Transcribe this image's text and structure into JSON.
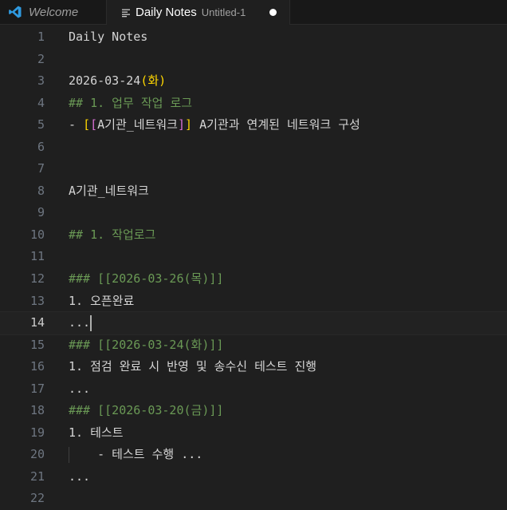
{
  "tabs": [
    {
      "label": "Welcome",
      "icon": "vscode-logo-icon"
    },
    {
      "label": "Daily Notes",
      "description": "Untitled-1",
      "icon": "file-lines-icon",
      "dirty": true
    }
  ],
  "lines": [
    {
      "n": "1",
      "text": "Daily Notes"
    },
    {
      "n": "2",
      "text": ""
    },
    {
      "n": "3",
      "date": "2026-03-24",
      "paren": "(화)"
    },
    {
      "n": "4",
      "text": "## 1. 업무 작업 로그"
    },
    {
      "n": "5",
      "prefix": "- ",
      "link": "A기관_네트워크",
      "suffix": " A기관과 연계된 네트워크 구성"
    },
    {
      "n": "6",
      "text": ""
    },
    {
      "n": "7",
      "text": ""
    },
    {
      "n": "8",
      "text": "A기관_네트워크"
    },
    {
      "n": "9",
      "text": ""
    },
    {
      "n": "10",
      "text": "## 1. 작업로그"
    },
    {
      "n": "11",
      "text": ""
    },
    {
      "n": "12",
      "text": "### [[2026-03-26(목)]]"
    },
    {
      "n": "13",
      "text": "1. 오픈완료"
    },
    {
      "n": "14",
      "text": "..."
    },
    {
      "n": "15",
      "text": "### [[2026-03-24(화)]]"
    },
    {
      "n": "16",
      "text": "1. 점검 완료 시 반영 및 송수신 테스트 진행"
    },
    {
      "n": "17",
      "text": "..."
    },
    {
      "n": "18",
      "text": "### [[2026-03-20(금)]]"
    },
    {
      "n": "19",
      "text": "1. 테스트"
    },
    {
      "n": "20",
      "text": "    - 테스트 수행 ..."
    },
    {
      "n": "21",
      "text": "..."
    },
    {
      "n": "22",
      "text": ""
    }
  ]
}
